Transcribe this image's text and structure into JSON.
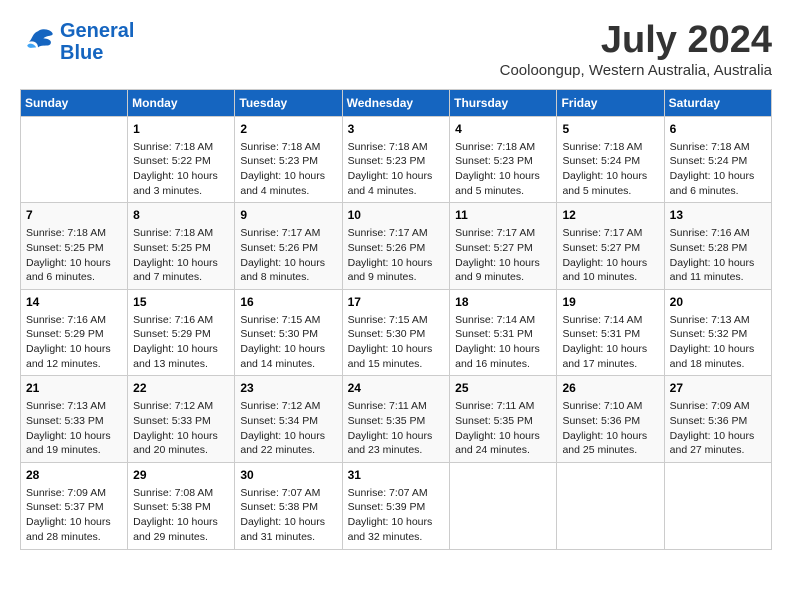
{
  "header": {
    "logo_general": "General",
    "logo_blue": "Blue",
    "month": "July 2024",
    "location": "Cooloongup, Western Australia, Australia"
  },
  "days_of_week": [
    "Sunday",
    "Monday",
    "Tuesday",
    "Wednesday",
    "Thursday",
    "Friday",
    "Saturday"
  ],
  "weeks": [
    [
      {
        "day": "",
        "info": ""
      },
      {
        "day": "1",
        "info": "Sunrise: 7:18 AM\nSunset: 5:22 PM\nDaylight: 10 hours\nand 3 minutes."
      },
      {
        "day": "2",
        "info": "Sunrise: 7:18 AM\nSunset: 5:23 PM\nDaylight: 10 hours\nand 4 minutes."
      },
      {
        "day": "3",
        "info": "Sunrise: 7:18 AM\nSunset: 5:23 PM\nDaylight: 10 hours\nand 4 minutes."
      },
      {
        "day": "4",
        "info": "Sunrise: 7:18 AM\nSunset: 5:23 PM\nDaylight: 10 hours\nand 5 minutes."
      },
      {
        "day": "5",
        "info": "Sunrise: 7:18 AM\nSunset: 5:24 PM\nDaylight: 10 hours\nand 5 minutes."
      },
      {
        "day": "6",
        "info": "Sunrise: 7:18 AM\nSunset: 5:24 PM\nDaylight: 10 hours\nand 6 minutes."
      }
    ],
    [
      {
        "day": "7",
        "info": "Sunrise: 7:18 AM\nSunset: 5:25 PM\nDaylight: 10 hours\nand 6 minutes."
      },
      {
        "day": "8",
        "info": "Sunrise: 7:18 AM\nSunset: 5:25 PM\nDaylight: 10 hours\nand 7 minutes."
      },
      {
        "day": "9",
        "info": "Sunrise: 7:17 AM\nSunset: 5:26 PM\nDaylight: 10 hours\nand 8 minutes."
      },
      {
        "day": "10",
        "info": "Sunrise: 7:17 AM\nSunset: 5:26 PM\nDaylight: 10 hours\nand 9 minutes."
      },
      {
        "day": "11",
        "info": "Sunrise: 7:17 AM\nSunset: 5:27 PM\nDaylight: 10 hours\nand 9 minutes."
      },
      {
        "day": "12",
        "info": "Sunrise: 7:17 AM\nSunset: 5:27 PM\nDaylight: 10 hours\nand 10 minutes."
      },
      {
        "day": "13",
        "info": "Sunrise: 7:16 AM\nSunset: 5:28 PM\nDaylight: 10 hours\nand 11 minutes."
      }
    ],
    [
      {
        "day": "14",
        "info": "Sunrise: 7:16 AM\nSunset: 5:29 PM\nDaylight: 10 hours\nand 12 minutes."
      },
      {
        "day": "15",
        "info": "Sunrise: 7:16 AM\nSunset: 5:29 PM\nDaylight: 10 hours\nand 13 minutes."
      },
      {
        "day": "16",
        "info": "Sunrise: 7:15 AM\nSunset: 5:30 PM\nDaylight: 10 hours\nand 14 minutes."
      },
      {
        "day": "17",
        "info": "Sunrise: 7:15 AM\nSunset: 5:30 PM\nDaylight: 10 hours\nand 15 minutes."
      },
      {
        "day": "18",
        "info": "Sunrise: 7:14 AM\nSunset: 5:31 PM\nDaylight: 10 hours\nand 16 minutes."
      },
      {
        "day": "19",
        "info": "Sunrise: 7:14 AM\nSunset: 5:31 PM\nDaylight: 10 hours\nand 17 minutes."
      },
      {
        "day": "20",
        "info": "Sunrise: 7:13 AM\nSunset: 5:32 PM\nDaylight: 10 hours\nand 18 minutes."
      }
    ],
    [
      {
        "day": "21",
        "info": "Sunrise: 7:13 AM\nSunset: 5:33 PM\nDaylight: 10 hours\nand 19 minutes."
      },
      {
        "day": "22",
        "info": "Sunrise: 7:12 AM\nSunset: 5:33 PM\nDaylight: 10 hours\nand 20 minutes."
      },
      {
        "day": "23",
        "info": "Sunrise: 7:12 AM\nSunset: 5:34 PM\nDaylight: 10 hours\nand 22 minutes."
      },
      {
        "day": "24",
        "info": "Sunrise: 7:11 AM\nSunset: 5:35 PM\nDaylight: 10 hours\nand 23 minutes."
      },
      {
        "day": "25",
        "info": "Sunrise: 7:11 AM\nSunset: 5:35 PM\nDaylight: 10 hours\nand 24 minutes."
      },
      {
        "day": "26",
        "info": "Sunrise: 7:10 AM\nSunset: 5:36 PM\nDaylight: 10 hours\nand 25 minutes."
      },
      {
        "day": "27",
        "info": "Sunrise: 7:09 AM\nSunset: 5:36 PM\nDaylight: 10 hours\nand 27 minutes."
      }
    ],
    [
      {
        "day": "28",
        "info": "Sunrise: 7:09 AM\nSunset: 5:37 PM\nDaylight: 10 hours\nand 28 minutes."
      },
      {
        "day": "29",
        "info": "Sunrise: 7:08 AM\nSunset: 5:38 PM\nDaylight: 10 hours\nand 29 minutes."
      },
      {
        "day": "30",
        "info": "Sunrise: 7:07 AM\nSunset: 5:38 PM\nDaylight: 10 hours\nand 31 minutes."
      },
      {
        "day": "31",
        "info": "Sunrise: 7:07 AM\nSunset: 5:39 PM\nDaylight: 10 hours\nand 32 minutes."
      },
      {
        "day": "",
        "info": ""
      },
      {
        "day": "",
        "info": ""
      },
      {
        "day": "",
        "info": ""
      }
    ]
  ]
}
